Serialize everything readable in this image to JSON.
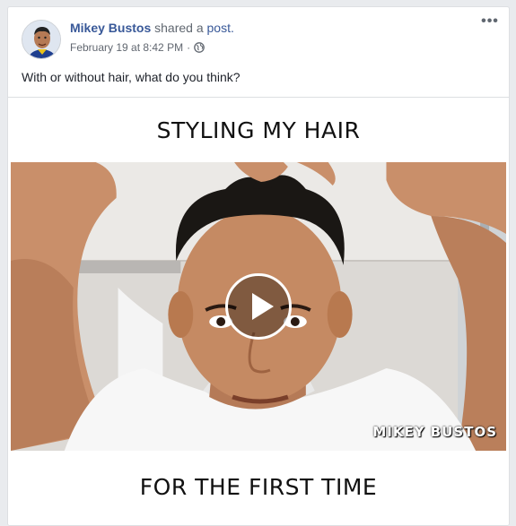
{
  "post": {
    "author": "Mikey Bustos",
    "action_text": " shared a ",
    "action_link": "post.",
    "timestamp": "February 19 at 8:42 PM",
    "separator": "·",
    "privacy_icon": "globe-icon",
    "more_icon": "more-options-icon",
    "more_glyph": "•••",
    "caption": "With or without hair, what do you think?"
  },
  "media": {
    "top_text": "STYLING MY HAIR",
    "bottom_text": "FOR THE FIRST TIME",
    "watermark": "MIKEY BUSTOS",
    "play_icon": "play-icon"
  },
  "colors": {
    "link": "#385898",
    "meta": "#616770",
    "background": "#e9ebee"
  }
}
